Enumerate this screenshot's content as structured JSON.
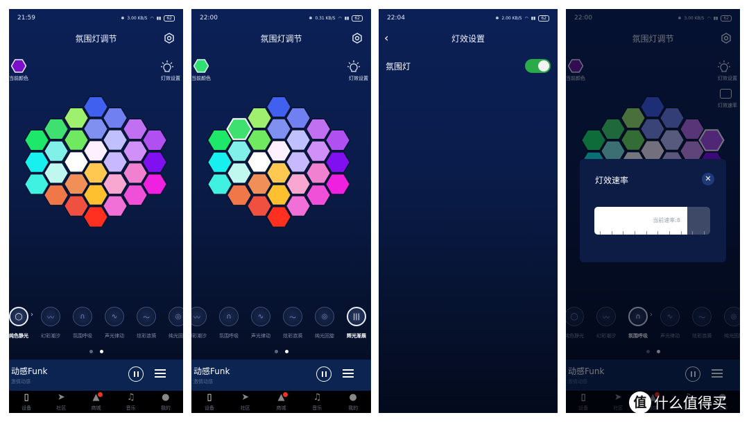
{
  "phones": [
    {
      "screen": "main",
      "status": {
        "time": "21:59",
        "speed": "3.00",
        "battery": "62"
      },
      "title": "氛围灯调节",
      "current_color_label": "当前颜色",
      "current_color": "#7a10c8",
      "effect_settings_label": "灯效设置",
      "selected_effect": 0,
      "effect_start": 0,
      "selected_hex": null
    },
    {
      "screen": "main",
      "status": {
        "time": "22:00",
        "speed": "0.31",
        "battery": "62"
      },
      "title": "氛围灯调节",
      "current_color_label": "当前颜色",
      "current_color": "#30e070",
      "effect_settings_label": "灯效设置",
      "selected_effect": 6,
      "effect_start": 0,
      "selected_hex": [
        1,
        0
      ]
    },
    {
      "screen": "settings",
      "status": {
        "time": "22:04",
        "speed": "2.00",
        "battery": "62"
      },
      "title": "灯效设置",
      "back_icon": "chevron-left-icon",
      "setting_label": "氛围灯",
      "setting_on": true
    },
    {
      "screen": "main",
      "status": {
        "time": "22:00",
        "speed": "3.00",
        "battery": "62"
      },
      "title": "氛围灯调节",
      "current_color_label": "当前颜色",
      "current_color": "#6a1aa0",
      "effect_settings_label": "灯效设置",
      "effect_speed_label": "灯效速率",
      "selected_effect": 2,
      "selected_hex": [
        6,
        0
      ],
      "modal": {
        "title": "灯效速率",
        "slider_text": "当前速率:8",
        "speed_value": 8,
        "speed_max": 10
      }
    }
  ],
  "speed_unit": "KB/S",
  "effects": [
    "纯色静光",
    "幻彩潮汐",
    "氛围呼吸",
    "声光律动",
    "炫彩涟漪",
    "纯光回旋",
    "辉光渐展"
  ],
  "effect_icons": [
    "◯",
    "〰",
    "∩",
    "∿",
    "～",
    "◎",
    "|||"
  ],
  "hex_columns": [
    [
      "#1de86a",
      "#18f0f0",
      "#40f0e0"
    ],
    [
      "#40e070",
      "#80f0e8",
      "#c0f8f0",
      "#f07848"
    ],
    [
      "#a0f070",
      "#70e860",
      "#ffffff",
      "#f09058",
      "#f05040"
    ],
    [
      "#4060f0",
      "#8090f0",
      "#fff0ff",
      "#ffc850",
      "#ffc030",
      "#ff3020"
    ],
    [
      "#7080f0",
      "#c0c0ff",
      "#c8b8ff",
      "#f8a8d0",
      "#f070d8"
    ],
    [
      "#c070f0",
      "#d090f8",
      "#f080d0",
      "#f050d8"
    ],
    [
      "#b050f0",
      "#8010f0",
      "#f020e0"
    ]
  ],
  "now_playing": {
    "title": "动感Funk",
    "subtitle": "激情动感"
  },
  "nav": [
    {
      "label": "设备",
      "icon": "speaker-icon",
      "glyph": "▯"
    },
    {
      "label": "社区",
      "icon": "paper-plane-icon",
      "glyph": "➤"
    },
    {
      "label": "商城",
      "icon": "shopping-bag-icon",
      "glyph": "▲",
      "badge": true
    },
    {
      "label": "音乐",
      "icon": "music-note-icon",
      "glyph": "♫"
    },
    {
      "label": "我的",
      "icon": "user-icon",
      "glyph": "●"
    }
  ],
  "accent_toggle": "#2aaa48",
  "watermark": {
    "seal": "值",
    "text": "什么值得买"
  }
}
